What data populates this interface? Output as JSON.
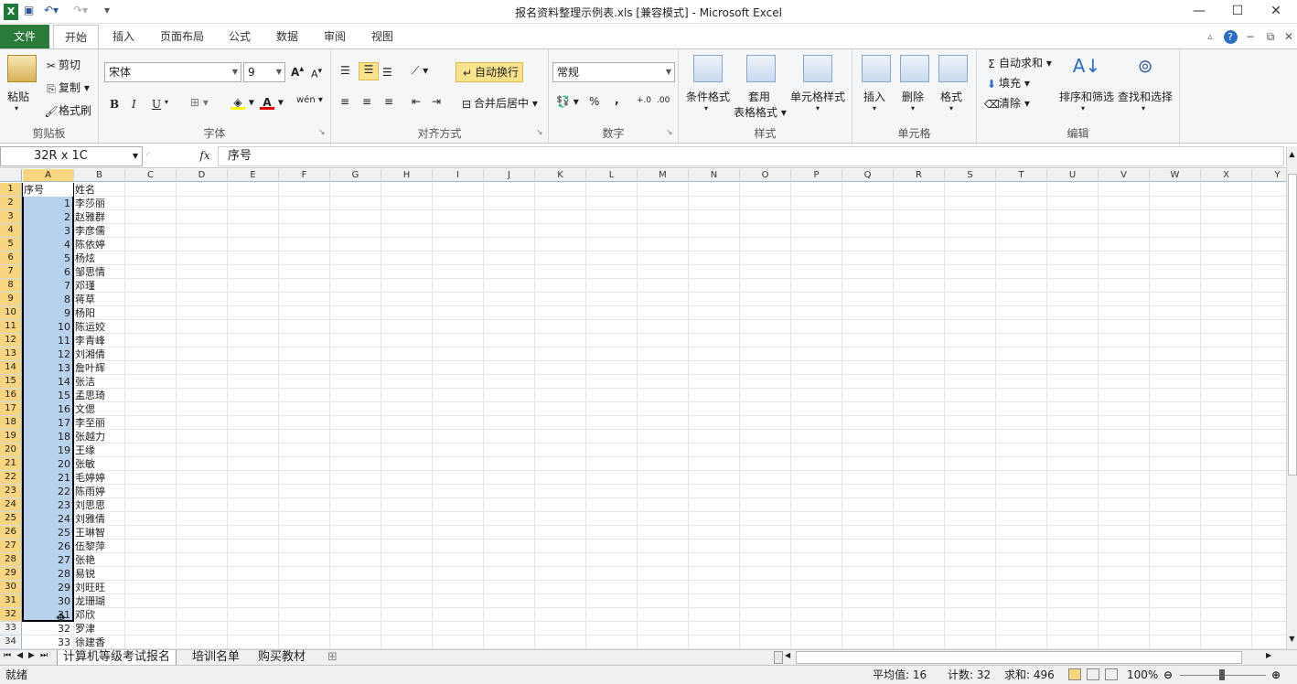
{
  "window": {
    "title": "报名资料整理示例表.xls  [兼容模式]  -  Microsoft Excel"
  },
  "ribbon_tabs": [
    "文件",
    "开始",
    "插入",
    "页面布局",
    "公式",
    "数据",
    "审阅",
    "视图"
  ],
  "clipboard": {
    "paste": "粘贴",
    "cut": "剪切",
    "copy": "复制",
    "format_painter": "格式刷",
    "label": "剪贴板"
  },
  "font": {
    "name": "宋体",
    "size": "9",
    "label": "字体",
    "bold": "B",
    "italic": "I",
    "underline": "U",
    "wen": "wén"
  },
  "alignment": {
    "wrap": "自动换行",
    "merge": "合并后居中",
    "label": "对齐方式"
  },
  "number": {
    "format": "常规",
    "label": "数字",
    "percent": "%",
    "comma": ","
  },
  "styles": {
    "conditional": "条件格式",
    "table1": "套用",
    "table2": "表格格式",
    "cell_styles": "单元格样式",
    "label": "样式"
  },
  "cells": {
    "insert": "插入",
    "delete": "删除",
    "format": "格式",
    "label": "单元格"
  },
  "editing": {
    "autosum": "自动求和",
    "fill": "填充",
    "clear": "清除",
    "sort": "排序和筛选",
    "find": "查找和选择",
    "label": "编辑"
  },
  "formula_bar": {
    "name_box": "32R  x  1C",
    "fx": "fx",
    "content": "序号"
  },
  "columns": [
    "A",
    "B",
    "C",
    "D",
    "E",
    "F",
    "G",
    "H",
    "I",
    "J",
    "K",
    "L",
    "M",
    "N",
    "O",
    "P",
    "Q",
    "R",
    "S",
    "T",
    "U",
    "V",
    "W",
    "X",
    "Y"
  ],
  "rows": [
    {
      "n": "1",
      "a": "序号",
      "b": "姓名"
    },
    {
      "n": "2",
      "a": "1",
      "b": "李莎丽"
    },
    {
      "n": "3",
      "a": "2",
      "b": "赵雅群"
    },
    {
      "n": "4",
      "a": "3",
      "b": "李彦儒"
    },
    {
      "n": "5",
      "a": "4",
      "b": "陈依婷"
    },
    {
      "n": "6",
      "a": "5",
      "b": "杨炫"
    },
    {
      "n": "7",
      "a": "6",
      "b": "邹思情"
    },
    {
      "n": "8",
      "a": "7",
      "b": "邓瑾"
    },
    {
      "n": "9",
      "a": "8",
      "b": "蒋草"
    },
    {
      "n": "10",
      "a": "9",
      "b": "杨阳"
    },
    {
      "n": "11",
      "a": "10",
      "b": "陈运姣"
    },
    {
      "n": "12",
      "a": "11",
      "b": "李青峰"
    },
    {
      "n": "13",
      "a": "12",
      "b": "刘湘倩"
    },
    {
      "n": "14",
      "a": "13",
      "b": "詹叶辉"
    },
    {
      "n": "15",
      "a": "14",
      "b": "张洁"
    },
    {
      "n": "16",
      "a": "15",
      "b": "孟思琦"
    },
    {
      "n": "17",
      "a": "16",
      "b": "文偲"
    },
    {
      "n": "18",
      "a": "17",
      "b": "李至丽"
    },
    {
      "n": "19",
      "a": "18",
      "b": "张越力"
    },
    {
      "n": "20",
      "a": "19",
      "b": "王缘"
    },
    {
      "n": "21",
      "a": "20",
      "b": "张敏"
    },
    {
      "n": "22",
      "a": "21",
      "b": "毛婷婷"
    },
    {
      "n": "23",
      "a": "22",
      "b": "陈雨婷"
    },
    {
      "n": "24",
      "a": "23",
      "b": "刘思思"
    },
    {
      "n": "25",
      "a": "24",
      "b": "刘雅倩"
    },
    {
      "n": "26",
      "a": "25",
      "b": "王琳智"
    },
    {
      "n": "27",
      "a": "26",
      "b": "伍黎萍"
    },
    {
      "n": "28",
      "a": "27",
      "b": "张艳"
    },
    {
      "n": "29",
      "a": "28",
      "b": "易锐"
    },
    {
      "n": "30",
      "a": "29",
      "b": "刘旺旺"
    },
    {
      "n": "31",
      "a": "30",
      "b": "龙珊瑚"
    },
    {
      "n": "32",
      "a": "31",
      "b": "邓欣"
    },
    {
      "n": "33",
      "a": "32",
      "b": "罗津"
    },
    {
      "n": "34",
      "a": "33",
      "b": "徐建香"
    }
  ],
  "sheet_tabs": [
    "计算机等级考试报名",
    "培训名单",
    "购买教材"
  ],
  "status": {
    "ready": "就绪",
    "average": "平均值: 16",
    "count": "计数: 32",
    "sum": "求和: 496",
    "zoom": "100%"
  },
  "colors": {
    "file_tab": "#2a7a3a",
    "selection": "#b8d2ee",
    "header_highlight": "#f8d57e"
  }
}
